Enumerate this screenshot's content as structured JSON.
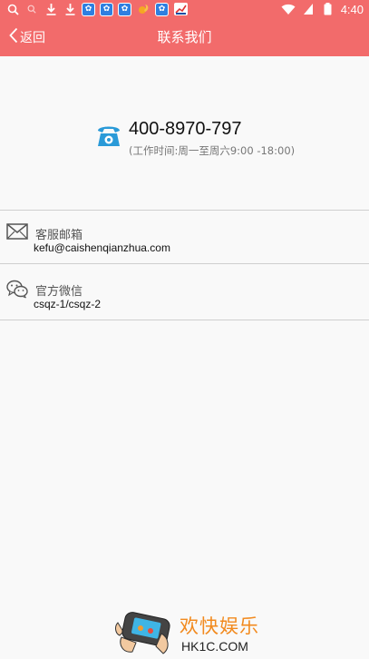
{
  "status_bar": {
    "left_icons": [
      "search-icon",
      "search-small-icon",
      "download-icon",
      "download-icon",
      "baidu-app-icon",
      "baidu-app-icon",
      "baidu-app-icon",
      "squirrel-app-icon",
      "baidu-app-icon",
      "chart-app-icon"
    ],
    "battery_label": "4",
    "time": "4:40"
  },
  "nav": {
    "back_label": "返回",
    "title": "联系我们"
  },
  "phone": {
    "number": "400-8970-797",
    "hours": "(工作时间:周一至周六9:00 -18:00)"
  },
  "email": {
    "label": "客服邮箱",
    "value": "kefu@caishenqianzhua.com"
  },
  "wechat": {
    "label": "官方微信",
    "value": "csqz-1/csqz-2"
  },
  "watermark": {
    "title": "欢快娱乐",
    "site": "HK1C.COM"
  },
  "colors": {
    "header": "#f26b6b",
    "background": "#f9f9f9",
    "phone_icon": "#2a9ad8",
    "watermark_accent": "#f28a1e"
  }
}
